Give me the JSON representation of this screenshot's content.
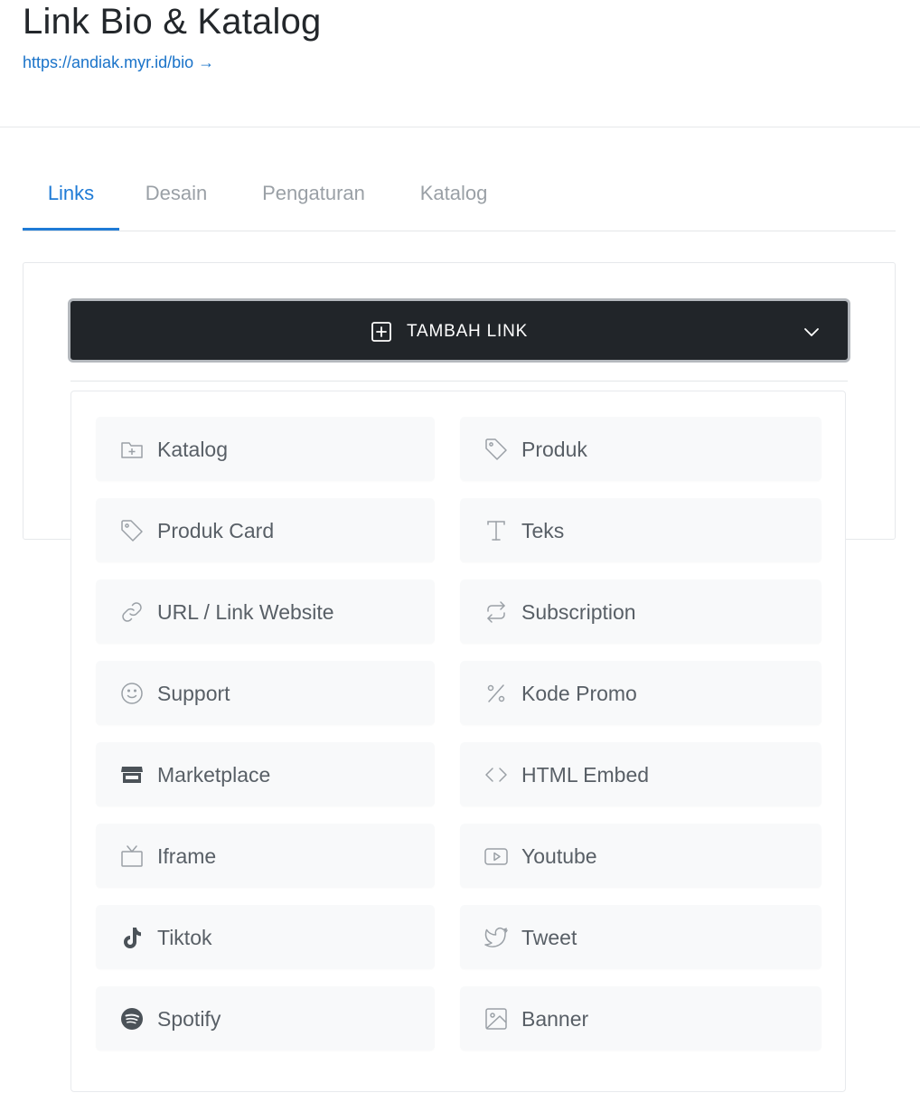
{
  "header": {
    "title": "Link Bio & Katalog",
    "bio_url": "https://andiak.myr.id/bio →"
  },
  "tabs": [
    {
      "label": "Links",
      "active": true
    },
    {
      "label": "Desain",
      "active": false
    },
    {
      "label": "Pengaturan",
      "active": false
    },
    {
      "label": "Katalog",
      "active": false
    }
  ],
  "add_button": {
    "label": "TAMBAH LINK",
    "icon": "plus-square-icon",
    "expanded": true
  },
  "link_types": [
    {
      "label": "Katalog",
      "icon": "folder-plus-icon"
    },
    {
      "label": "Produk",
      "icon": "tag-icon"
    },
    {
      "label": "Produk Card",
      "icon": "tag-icon"
    },
    {
      "label": "Teks",
      "icon": "text-icon"
    },
    {
      "label": "URL / Link Website",
      "icon": "link-icon"
    },
    {
      "label": "Subscription",
      "icon": "repeat-icon"
    },
    {
      "label": "Support",
      "icon": "smile-icon"
    },
    {
      "label": "Kode Promo",
      "icon": "percent-icon"
    },
    {
      "label": "Marketplace",
      "icon": "store-icon"
    },
    {
      "label": "HTML Embed",
      "icon": "code-icon"
    },
    {
      "label": "Iframe",
      "icon": "tv-icon"
    },
    {
      "label": "Youtube",
      "icon": "youtube-icon"
    },
    {
      "label": "Tiktok",
      "icon": "tiktok-icon"
    },
    {
      "label": "Tweet",
      "icon": "twitter-icon"
    },
    {
      "label": "Spotify",
      "icon": "spotify-icon"
    },
    {
      "label": "Banner",
      "icon": "image-icon"
    }
  ],
  "colors": {
    "accent": "#1f7bd6",
    "button_bg": "#212529",
    "item_bg": "#f8f9fa",
    "item_text": "#585f66",
    "icon_gray": "#9aa0a6"
  }
}
